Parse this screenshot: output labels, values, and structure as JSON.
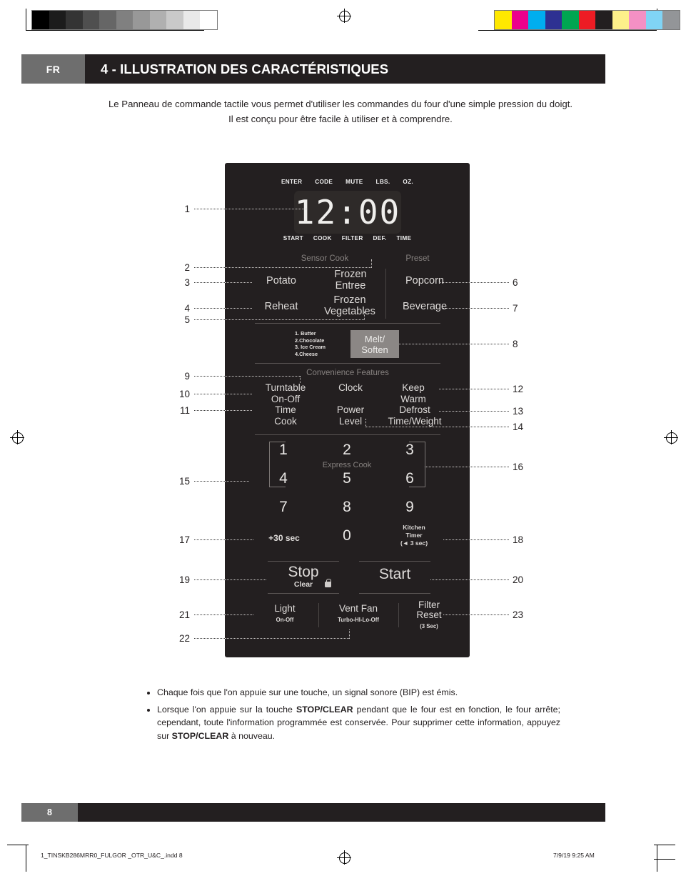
{
  "print_marks": {
    "gray_bar": [
      "#000000",
      "#1c1c1c",
      "#343434",
      "#4f4f4f",
      "#666666",
      "#808080",
      "#989898",
      "#b0b0b0",
      "#c9c9c9",
      "#e9e9e9",
      "#ffffff"
    ],
    "color_bar": [
      "#ffe800",
      "#ec008c",
      "#00aeef",
      "#2e3192",
      "#00a651",
      "#ed1c24",
      "#231f20",
      "#fdf08a",
      "#f490c4",
      "#80d4f5",
      "#939598"
    ]
  },
  "header": {
    "language": "FR",
    "title": "4 - ILLUSTRATION DES CARACTÉRISTIQUES"
  },
  "intro": {
    "line1": "Le Panneau de commande tactile vous permet d'utiliser les commandes du four d'une simple pression du doigt.",
    "line2": "Il est conçu pour être facile à utiliser et à comprendre."
  },
  "panel": {
    "indicators_top": [
      "ENTER",
      "CODE",
      "MUTE",
      "LBS.",
      "OZ."
    ],
    "display_value": "12:00",
    "indicators_bottom": [
      "START",
      "COOK",
      "FILTER",
      "DEF.",
      "TIME"
    ],
    "section_sensor_cook": "Sensor Cook",
    "section_preset": "Preset",
    "section_convenience": "Convenience Features",
    "buttons": {
      "potato": "Potato",
      "reheat": "Reheat",
      "frozen_entree_l1": "Frozen",
      "frozen_entree_l2": "Entree",
      "frozen_vegetables_l1": "Frozen",
      "frozen_vegetables_l2": "Vegetables",
      "popcorn": "Popcorn",
      "beverage": "Beverage",
      "melt_l1": "Melt/",
      "melt_l2": "Soften",
      "melt_list": [
        "1. Butter",
        "2.Chocolate",
        "3. Ice Cream",
        "4.Cheese"
      ],
      "turntable_l1": "Turntable",
      "turntable_l2": "On-Off",
      "clock": "Clock",
      "keep_l1": "Keep",
      "keep_l2": "Warm",
      "time_cook_l1": "Time",
      "time_cook_l2": "Cook",
      "power_level_l1": "Power",
      "power_level_l2": "Level",
      "defrost_l1": "Defrost",
      "defrost_l2": "Time/Weight",
      "express_cook": "Express Cook",
      "plus30": "+30 sec",
      "kitchen_timer_l1": "Kitchen",
      "kitchen_timer_l2": "Timer",
      "kitchen_timer_l3": "(◄ 3 sec)",
      "stop": "Stop",
      "clear": "Clear",
      "start": "Start",
      "light_l1": "Light",
      "light_l2": "On-Off",
      "vent_fan_l1": "Vent Fan",
      "vent_fan_l2": "Turbo-HI-Lo-Off",
      "filter_reset_l1": "Filter",
      "filter_reset_l2": "Reset",
      "filter_reset_l3": "(3 Sec)"
    },
    "keypad": [
      "1",
      "2",
      "3",
      "4",
      "5",
      "6",
      "7",
      "8",
      "9",
      "0"
    ]
  },
  "callouts_left": [
    "1",
    "2",
    "3",
    "4",
    "5",
    "9",
    "10",
    "11",
    "15",
    "17",
    "19",
    "21",
    "22"
  ],
  "callouts_right": [
    "6",
    "7",
    "8",
    "12",
    "13",
    "14",
    "16",
    "18",
    "20",
    "23"
  ],
  "bullets": {
    "b1": "Chaque fois que l'on appuie sur une touche, un signal sonore (BIP) est émis.",
    "b2_p1": "Lorsque l'on appuie sur la touche ",
    "b2_strong1": "STOP/CLEAR",
    "b2_p2": " pendant que le four est en fonction, le four arrête; cependant, toute l'information programmée est conservée. Pour supprimer cette information, appuyez sur ",
    "b2_strong2": "STOP/CLEAR",
    "b2_p3": " à nouveau."
  },
  "footer": {
    "page_number": "8",
    "file_info": "1_TINSKB286MRR0_FULGOR _OTR_U&C_.indd   8",
    "timestamp": "7/9/19   9:25 AM"
  }
}
